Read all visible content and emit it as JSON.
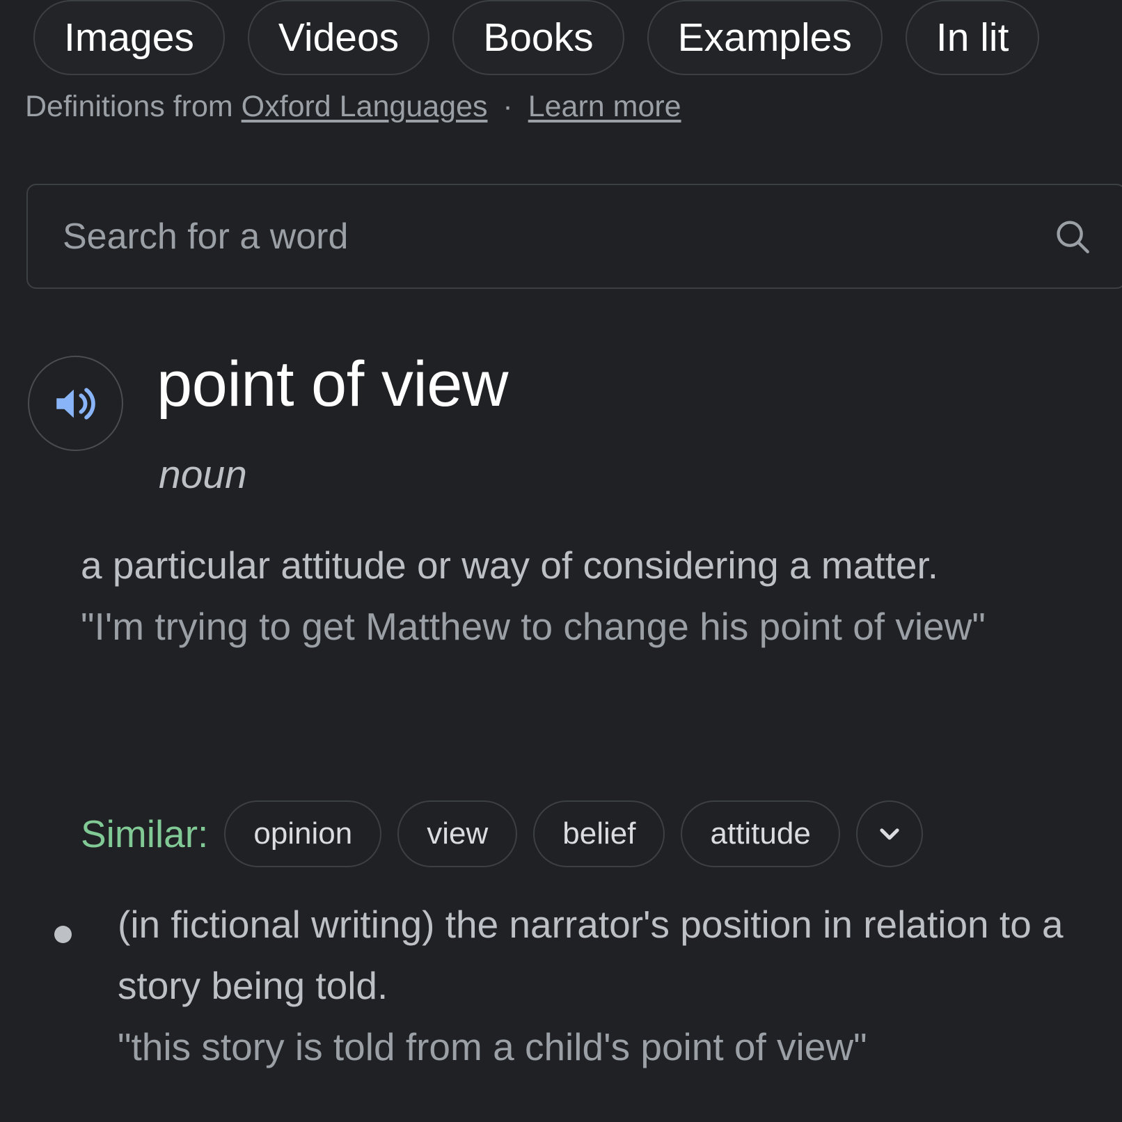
{
  "nav": {
    "chips": [
      {
        "label": "Images",
        "name": "nav-chip-images"
      },
      {
        "label": "Videos",
        "name": "nav-chip-videos"
      },
      {
        "label": "Books",
        "name": "nav-chip-books"
      },
      {
        "label": "Examples",
        "name": "nav-chip-examples"
      },
      {
        "label": "In lit",
        "name": "nav-chip-in-literature"
      }
    ]
  },
  "source": {
    "prefix": "Definitions from ",
    "provider": "Oxford Languages",
    "separator": " · ",
    "learn_more": "Learn more"
  },
  "word_search": {
    "placeholder": "Search for a word",
    "value": "",
    "icon": "search-icon"
  },
  "entry": {
    "speaker_icon": "volume-up-icon",
    "headword": "point of view",
    "part_of_speech": "noun",
    "senses": [
      {
        "definition": "a particular attitude or way of considering a matter.",
        "example": "\"I'm trying to get Matthew to change his point of view\"",
        "similar_label": "Similar:",
        "similar": [
          "opinion",
          "view",
          "belief",
          "attitude"
        ],
        "expand_icon": "chevron-down-icon"
      },
      {
        "definition": "(in fictional writing) the narrator's position in relation to a story being told.",
        "example": "\"this story is told from a child's point of view\""
      }
    ]
  },
  "colors": {
    "page_background": "#202124",
    "chip_border": "#3c4043",
    "headword_text": "#ffffff",
    "body_text": "#bdc1c6",
    "muted_text": "#9aa0a6",
    "accent_blue": "#8ab4f8",
    "similar_green": "#81c995"
  }
}
